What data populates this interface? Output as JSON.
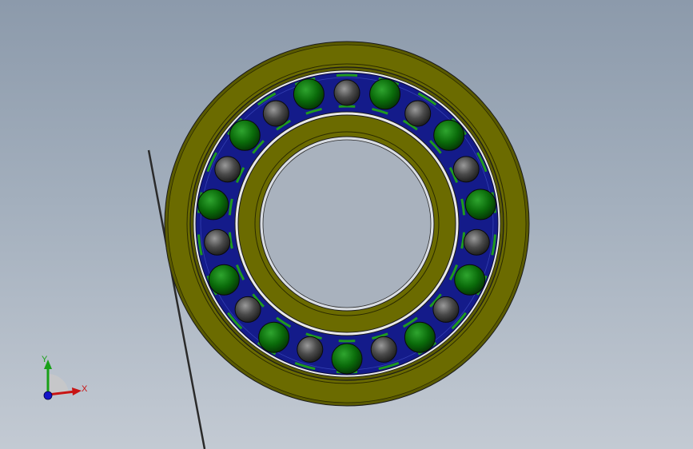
{
  "viewport": {
    "background_top": "#8c9aab",
    "background_bottom": "#c3cad3"
  },
  "bearing": {
    "ring_color": "#6b6b00",
    "cage_color": "#141b8a",
    "ball_colors": [
      "#0a6b0a",
      "#4a4a4a"
    ],
    "ball_count": 22,
    "edge_color": "#1a1a1a",
    "clip_color": "#1f9a1f"
  },
  "triad": {
    "x_label": "X",
    "y_label": "Y",
    "x_color": "#c81414",
    "y_color": "#18a018",
    "z_color": "#1414c8",
    "x_icon": "x-axis-arrow",
    "y_icon": "y-axis-arrow",
    "origin_icon": "origin-sphere"
  }
}
